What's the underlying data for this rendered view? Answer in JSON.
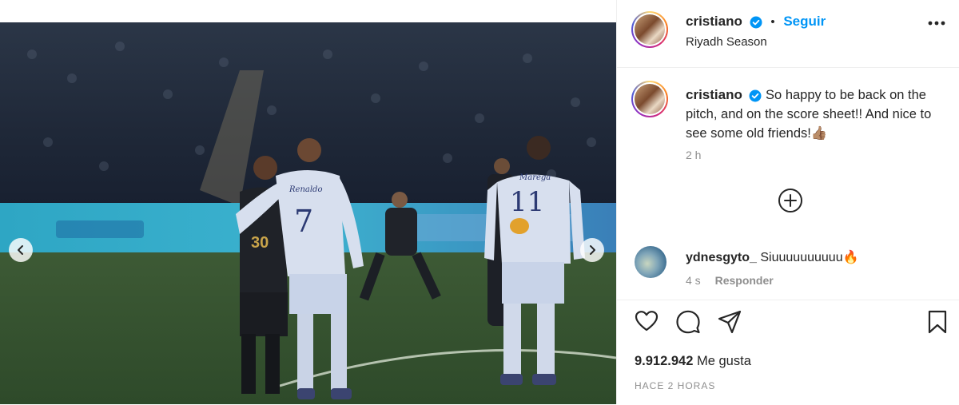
{
  "post": {
    "username": "cristiano",
    "follow_label": "Seguir",
    "separator": "•",
    "location": "Riyadh Season",
    "caption": "So happy to be back on the pitch, and on the score sheet!! And nice to see some old friends!👍🏽",
    "caption_time": "2 h",
    "likes_count": "9.912.942",
    "likes_label": "Me gusta",
    "posted_ago": "HACE 2 HORAS"
  },
  "photo": {
    "player_left_name": "Renaldo",
    "player_left_number": "7",
    "player_right_name": "Marega",
    "player_right_number": "11",
    "player_front_number": "30"
  },
  "comment": {
    "username": "ydnesgyto_",
    "text": "Siuuuuuuuuuu🔥",
    "time": "4 s",
    "reply_label": "Responder"
  },
  "colors": {
    "link_blue": "#0095f6",
    "text_dark": "#262626",
    "muted": "#8e8e8e",
    "verified_blue": "#0095f6"
  },
  "icons": [
    "verified-badge-icon",
    "more-options-icon",
    "add-comment-icon",
    "heart-icon",
    "comment-icon",
    "share-icon",
    "bookmark-icon",
    "chevron-left-icon",
    "chevron-right-icon"
  ]
}
